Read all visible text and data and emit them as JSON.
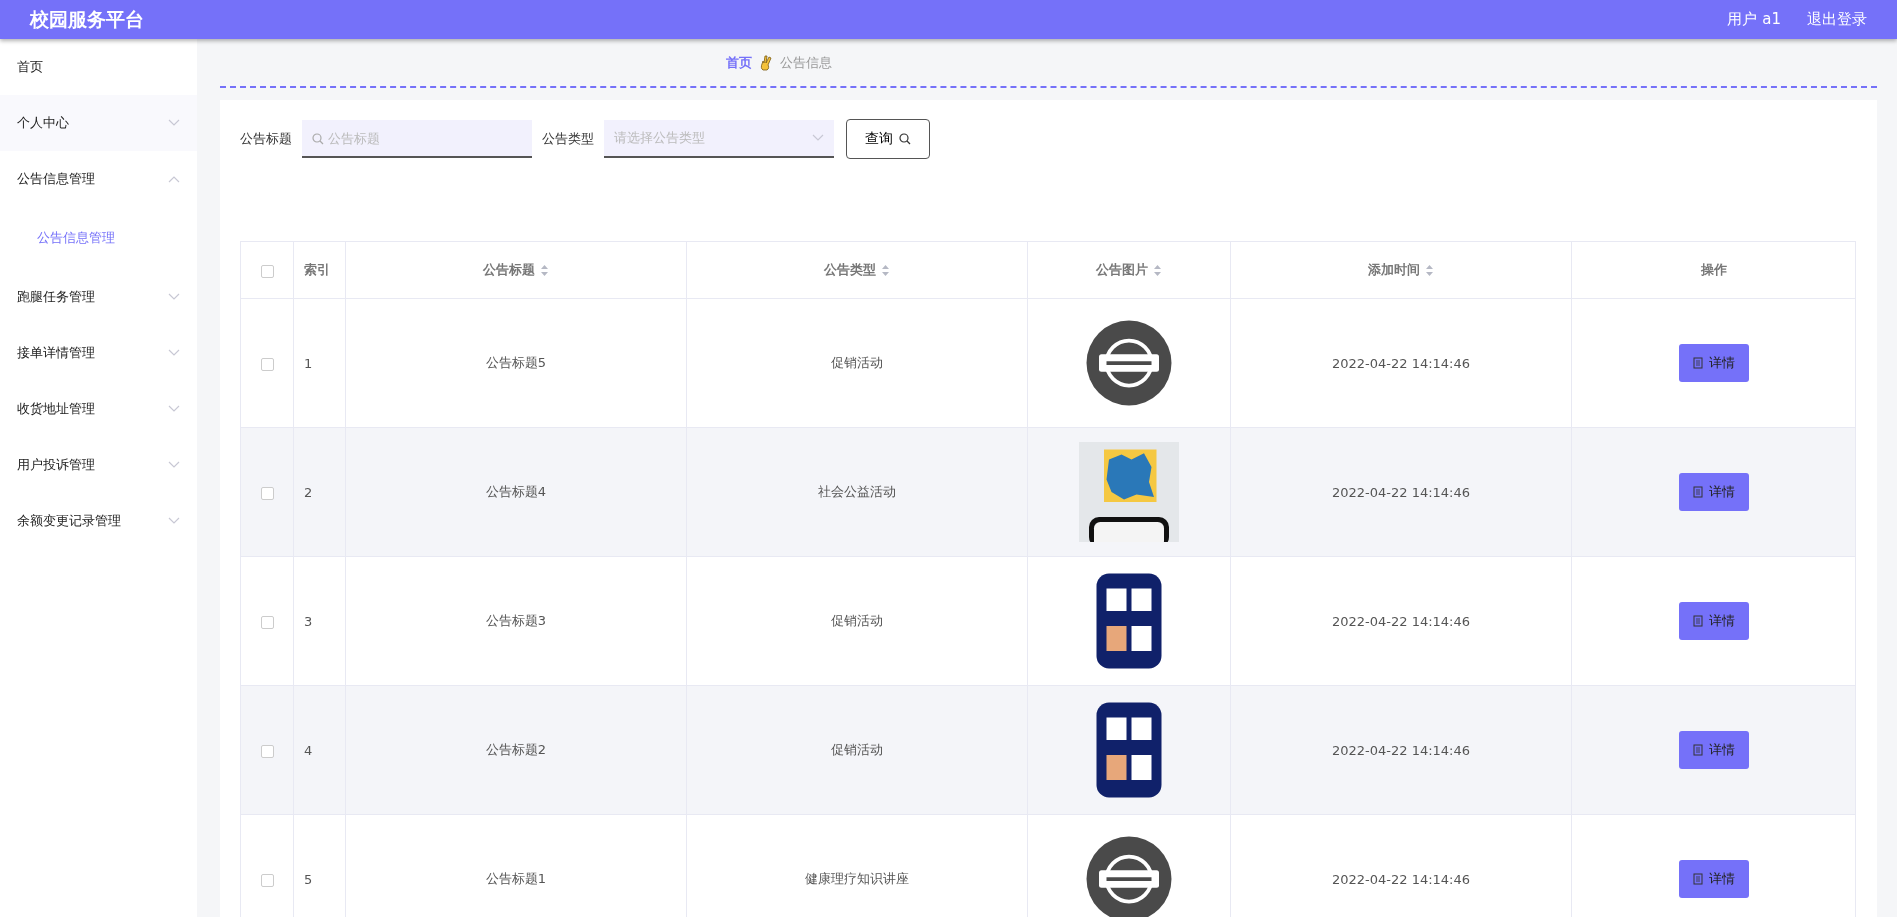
{
  "header": {
    "title": "校园服务平台",
    "user": "用户 a1",
    "logout": "退出登录"
  },
  "sidebar": {
    "items": [
      {
        "label": "首页",
        "kind": "link"
      },
      {
        "label": "个人中心",
        "kind": "menu",
        "expanded": false
      },
      {
        "label": "公告信息管理",
        "kind": "menu",
        "expanded": true,
        "children": [
          {
            "label": "公告信息管理",
            "selected": true
          }
        ]
      },
      {
        "label": "跑腿任务管理",
        "kind": "menu",
        "expanded": false
      },
      {
        "label": "接单详情管理",
        "kind": "menu",
        "expanded": false
      },
      {
        "label": "收货地址管理",
        "kind": "menu",
        "expanded": false
      },
      {
        "label": "用户投诉管理",
        "kind": "menu",
        "expanded": false
      },
      {
        "label": "余额变更记录管理",
        "kind": "menu",
        "expanded": false
      }
    ]
  },
  "breadcrumb": {
    "home": "首页",
    "current": "公告信息"
  },
  "search": {
    "title_label": "公告标题",
    "title_placeholder": "公告标题",
    "type_label": "公告类型",
    "type_placeholder": "请选择公告类型",
    "button": "查询"
  },
  "table": {
    "all_checked": false,
    "columns": [
      {
        "label": "索引",
        "sortable": false
      },
      {
        "label": "公告标题",
        "sortable": true
      },
      {
        "label": "公告类型",
        "sortable": true
      },
      {
        "label": "公告图片",
        "sortable": true
      },
      {
        "label": "添加时间",
        "sortable": true
      },
      {
        "label": "操作",
        "sortable": false
      }
    ],
    "rows": [
      {
        "checked": false,
        "index": "1",
        "title": "公告标题5",
        "type": "促销活动",
        "time": "2022-04-22 14:14:46",
        "action": "详情"
      },
      {
        "checked": false,
        "index": "2",
        "title": "公告标题4",
        "type": "社会公益活动",
        "time": "2022-04-22 14:14:46",
        "action": "详情"
      },
      {
        "checked": false,
        "index": "3",
        "title": "公告标题3",
        "type": "促销活动",
        "time": "2022-04-22 14:14:46",
        "action": "详情"
      },
      {
        "checked": false,
        "index": "4",
        "title": "公告标题2",
        "type": "促销活动",
        "time": "2022-04-22 14:14:46",
        "action": "详情"
      },
      {
        "checked": false,
        "index": "5",
        "title": "公告标题1",
        "type": "健康理疗知识讲座",
        "time": "2022-04-22 14:14:46",
        "action": "详情"
      }
    ]
  }
}
